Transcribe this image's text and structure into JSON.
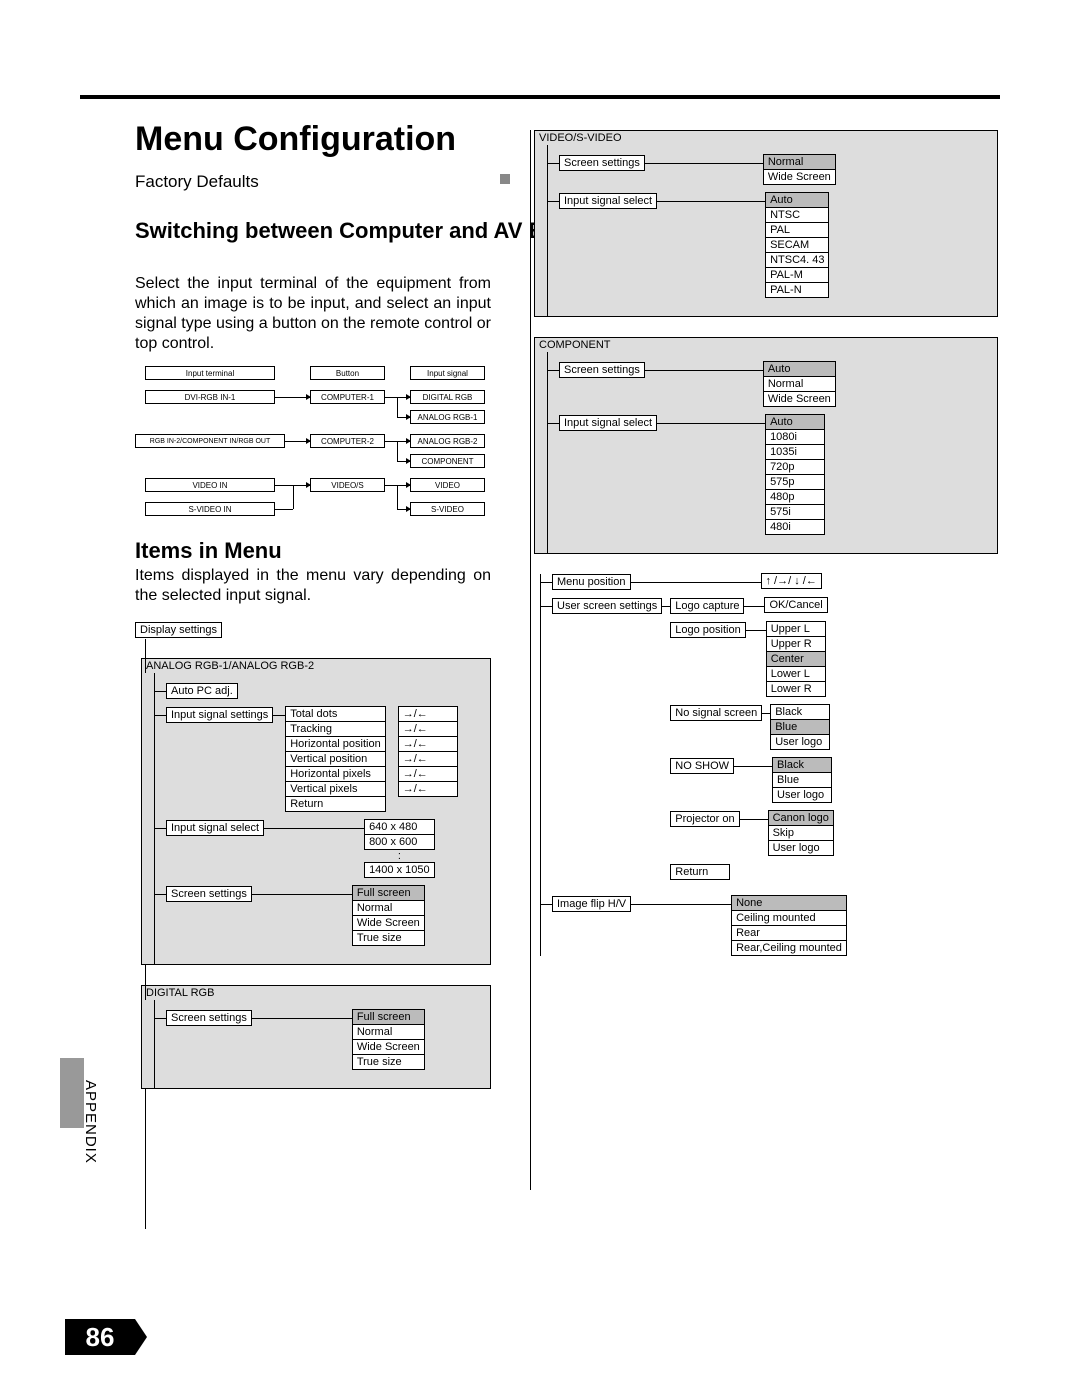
{
  "page_number": "86",
  "appendix_label": "APPENDIX",
  "title": "Menu Configuration",
  "factory_defaults": "Factory Defaults",
  "heading_switch": "Switching between Computer and AV Equipment",
  "para_switch": "Select the input terminal of the equipment from which an image is to be input, and select an input signal type using a button on the remote control or top control.",
  "heading_items": "Items in Menu",
  "para_items": "Items displayed in the menu vary depending on the selected input signal.",
  "diagram1": {
    "headers": {
      "c1": "Input terminal",
      "c2": "Button",
      "c3": "Input signal"
    },
    "r1": {
      "c1": "DVI-RGB IN-1",
      "c2": "COMPUTER-1",
      "c3a": "DIGITAL RGB",
      "c3b": "ANALOG RGB-1"
    },
    "r2": {
      "c1": "RGB IN-2/COMPONENT IN/RGB OUT",
      "c2": "COMPUTER-2",
      "c3a": "ANALOG RGB-2",
      "c3b": "COMPONENT"
    },
    "r3": {
      "c1": "VIDEO IN",
      "c2": "VIDEO/S",
      "c3": "VIDEO"
    },
    "r4": {
      "c1": "S-VIDEO IN",
      "c3": "S-VIDEO"
    }
  },
  "left_menu": {
    "root": "Display settings",
    "sec1": {
      "title": "ANALOG RGB-1/ANALOG RGB-2",
      "autopc": "Auto PC adj.",
      "iss_label": "Input signal settings",
      "iss": {
        "a": "Total dots",
        "b": "Tracking",
        "c": "Horizontal position",
        "d": "Vertical position",
        "e": "Horizontal pixels",
        "f": "Vertical pixels",
        "g": "Return"
      },
      "arrows": "→/←",
      "isel_label": "Input signal select",
      "isel": {
        "a": "640 x 480",
        "b": "800 x 600",
        "c": ":",
        "d": "1400 x 1050"
      },
      "scr_label": "Screen settings",
      "scr": {
        "a": "Full screen",
        "b": "Normal",
        "c": "Wide Screen",
        "d": "True size"
      }
    },
    "sec2": {
      "title": "DIGITAL RGB",
      "scr_label": "Screen settings",
      "scr": {
        "a": "Full screen",
        "b": "Normal",
        "c": "Wide Screen",
        "d": "True size"
      }
    }
  },
  "right_menu": {
    "sec_vs": {
      "title": "VIDEO/S-VIDEO",
      "scr_label": "Screen settings",
      "scr": {
        "a": "Normal",
        "b": "Wide Screen"
      },
      "isel_label": "Input signal select",
      "isel": {
        "a": "Auto",
        "b": "NTSC",
        "c": "PAL",
        "d": "SECAM",
        "e": "NTSC4. 43",
        "f": "PAL-M",
        "g": "PAL-N"
      }
    },
    "sec_comp": {
      "title": "COMPONENT",
      "scr_label": "Screen settings",
      "scr": {
        "a": "Auto",
        "b": "Normal",
        "c": "Wide Screen"
      },
      "isel_label": "Input signal select",
      "isel": {
        "a": "Auto",
        "b": "1080i",
        "c": "1035i",
        "d": "720p",
        "e": "575p",
        "f": "480p",
        "g": "575i",
        "h": "480i"
      }
    },
    "common": {
      "mp_label": "Menu position",
      "mp_opt": "↑ /→/ ↓ /←",
      "uss_label": "User screen settings",
      "logo_cap_label": "Logo capture",
      "logo_cap_opt": "OK/Cancel",
      "logo_pos_label": "Logo position",
      "logo_pos": {
        "a": "Upper L",
        "b": "Upper R",
        "c": "Center",
        "d": "Lower L",
        "e": "Lower R"
      },
      "nosig_label": "No signal screen",
      "nosig": {
        "a": "Black",
        "b": "Blue",
        "c": "User logo"
      },
      "noshow_label": "NO SHOW",
      "noshow": {
        "a": "Black",
        "b": "Blue",
        "c": "User logo"
      },
      "projon_label": "Projector on",
      "projon": {
        "a": "Canon logo",
        "b": "Skip",
        "c": "User logo"
      },
      "ret": "Return",
      "flip_label": "Image flip H/V",
      "flip": {
        "a": "None",
        "b": "Ceiling mounted",
        "c": "Rear",
        "d": "Rear,Ceiling mounted"
      }
    }
  }
}
